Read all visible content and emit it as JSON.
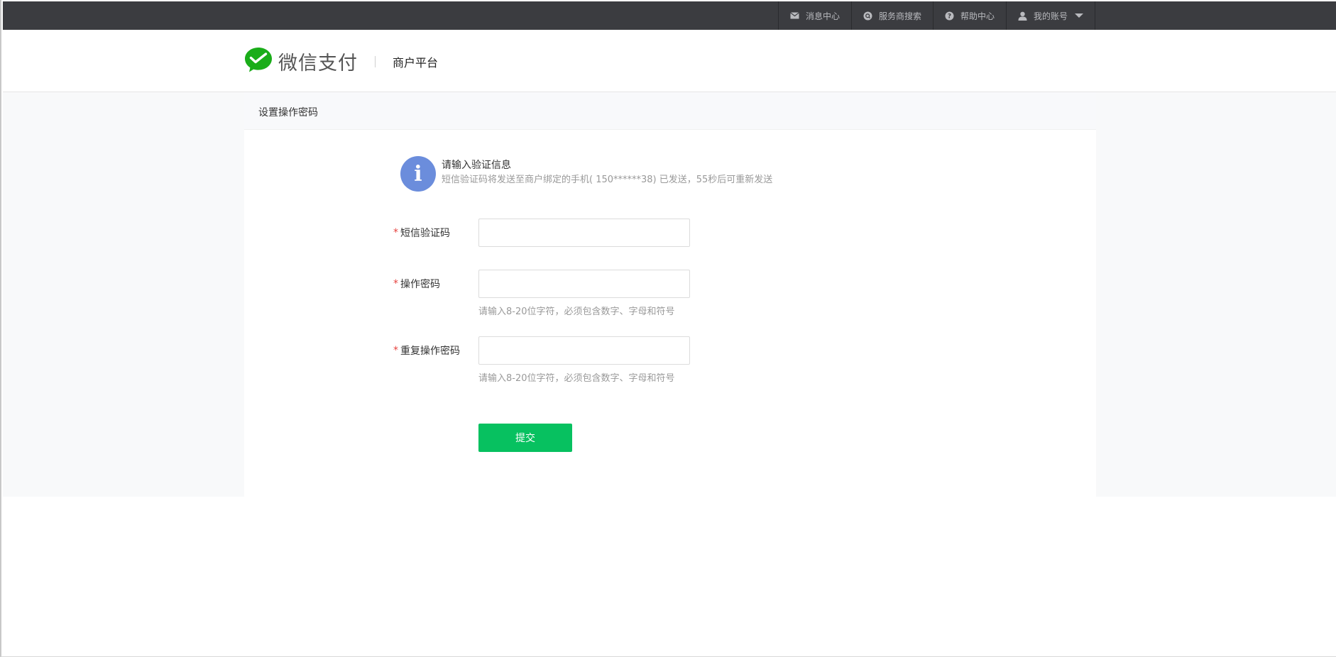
{
  "topbar": {
    "items": [
      {
        "label": "消息中心",
        "icon": "mail-icon"
      },
      {
        "label": "服务商搜索",
        "icon": "search-icon"
      },
      {
        "label": "帮助中心",
        "icon": "help-icon"
      },
      {
        "label": "我的账号",
        "icon": "user-icon"
      }
    ],
    "bg_color": "#3b3c40"
  },
  "header": {
    "logo_text": "微信支付",
    "subtitle": "商户平台",
    "brand_color": "#1aad19"
  },
  "page": {
    "title": "设置操作密码"
  },
  "notice": {
    "title": "请输入验证信息",
    "desc": "短信验证码将发送至商户绑定的手机( 150******38) 已发送，55秒后可重新发送",
    "icon": "info-icon"
  },
  "form": {
    "sms_label": "短信验证码",
    "password_label": "操作密码",
    "password_hint": "请输入8-20位字符，必须包含数字、字母和符号",
    "repeat_label": "重复操作密码",
    "repeat_hint": "请输入8-20位字符，必须包含数字、字母和符号",
    "required_mark": "*",
    "submit_label": "提交",
    "submit_color": "#07c160"
  }
}
